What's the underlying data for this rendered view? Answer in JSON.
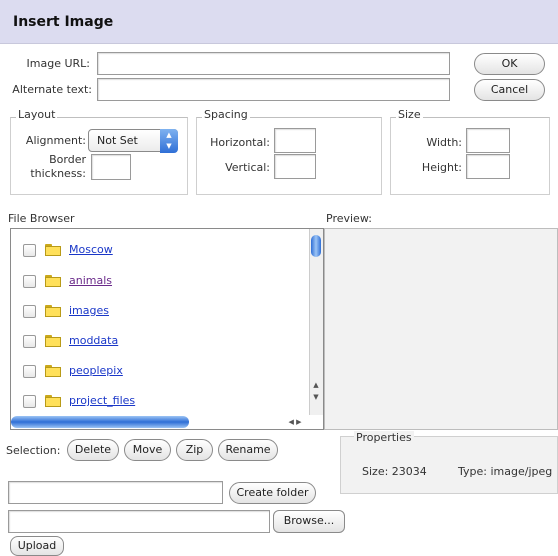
{
  "dialog": {
    "title": "Insert Image"
  },
  "fields": {
    "image_url_label": "Image URL:",
    "image_url_value": "",
    "alt_text_label": "Alternate text:",
    "alt_text_value": ""
  },
  "buttons": {
    "ok": "OK",
    "cancel": "Cancel"
  },
  "layout": {
    "legend": "Layout",
    "alignment_label": "Alignment:",
    "alignment_value": "Not Set",
    "border_label_1": "Border",
    "border_label_2": "thickness:",
    "border_value": ""
  },
  "spacing": {
    "legend": "Spacing",
    "horizontal_label": "Horizontal:",
    "vertical_label": "Vertical:",
    "horizontal_value": "",
    "vertical_value": ""
  },
  "size": {
    "legend": "Size",
    "width_label": "Width:",
    "height_label": "Height:",
    "width_value": "",
    "height_value": ""
  },
  "file_browser": {
    "label": "File Browser",
    "items": [
      {
        "name": "Moscow"
      },
      {
        "name": "animals"
      },
      {
        "name": "images"
      },
      {
        "name": "moddata"
      },
      {
        "name": "peoplepix"
      },
      {
        "name": "project_files"
      }
    ]
  },
  "preview": {
    "label": "Preview:"
  },
  "selection": {
    "label": "Selection:",
    "delete": "Delete",
    "move": "Move",
    "zip": "Zip",
    "rename": "Rename"
  },
  "properties": {
    "legend": "Properties",
    "size_label": "Size:",
    "size_value": "23034",
    "type_label": "Type:",
    "type_value": "image/jpeg"
  },
  "folder": {
    "name_value": "",
    "create_button": "Create folder"
  },
  "upload": {
    "file_value": "",
    "browse_button": "Browse...",
    "upload_button": "Upload"
  },
  "colors": {
    "title_bar": "#dcdcf0",
    "link": "#1a37c8",
    "folder": "#ffe05a",
    "scroll_accent": "#2f6fd6"
  },
  "icons": [
    "folder-icon",
    "checkbox-icon",
    "select-arrows-icon",
    "scroll-arrow-icon"
  ]
}
